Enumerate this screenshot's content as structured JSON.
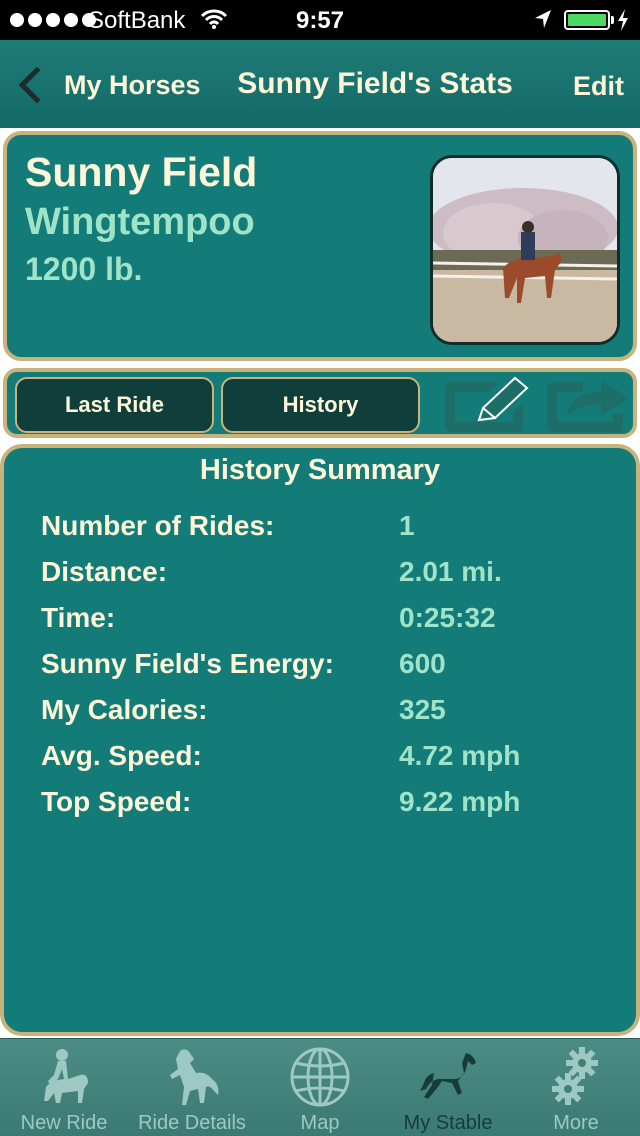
{
  "status_bar": {
    "carrier": "SoftBank",
    "time": "9:57",
    "battery_color": "#4cd964"
  },
  "nav": {
    "back_label": "My Horses",
    "title": "Sunny Field's Stats",
    "edit_label": "Edit"
  },
  "horse": {
    "name": "Sunny Field",
    "breed": "Wingtempoo",
    "weight": "1200 lb."
  },
  "controls": {
    "last_ride_label": "Last Ride",
    "history_label": "History",
    "edit_icon": "pencil-edit-icon",
    "share_icon": "share-arrow-icon"
  },
  "summary": {
    "title": "History Summary",
    "stats": [
      {
        "label": "Number of Rides:",
        "value": "1"
      },
      {
        "label": "Distance:",
        "value": "2.01 mi."
      },
      {
        "label": "Time:",
        "value": "0:25:32"
      },
      {
        "label": "Sunny Field's Energy:",
        "value": "600"
      },
      {
        "label": "My Calories:",
        "value": "325"
      },
      {
        "label": "Avg. Speed:",
        "value": "4.72 mph"
      },
      {
        "label": "Top Speed:",
        "value": "9.22 mph"
      }
    ]
  },
  "tabs": [
    {
      "label": "New Ride",
      "icon": "rider-horse-icon"
    },
    {
      "label": "Ride Details",
      "icon": "rearing-horse-icon"
    },
    {
      "label": "Map",
      "icon": "globe-icon"
    },
    {
      "label": "My Stable",
      "icon": "running-horse-icon",
      "active": true
    },
    {
      "label": "More",
      "icon": "gears-icon"
    }
  ],
  "colors": {
    "teal": "#147c78",
    "gold_border": "#c9b37d",
    "cream_text": "#fdf6d8",
    "mint_text": "#9fe3c9"
  }
}
